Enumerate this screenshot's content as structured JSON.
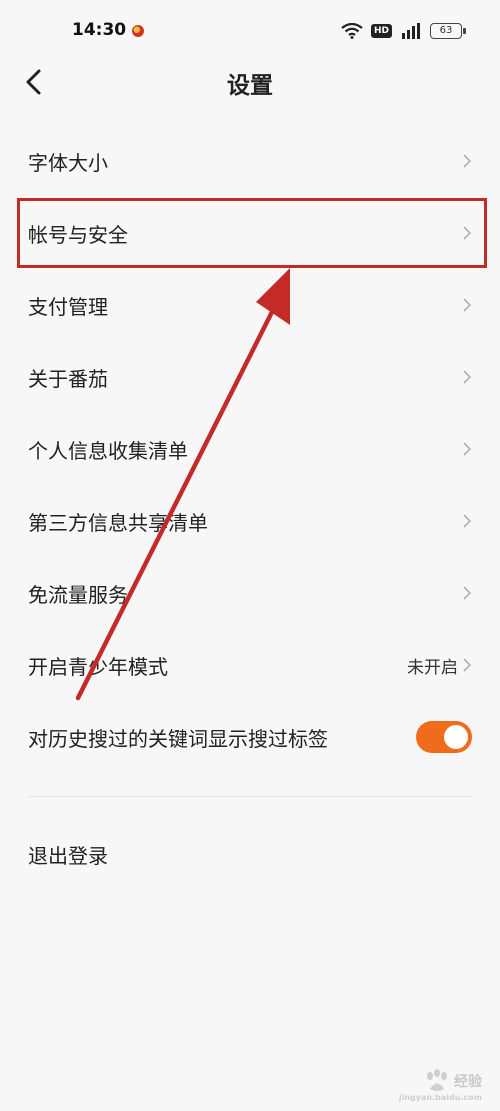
{
  "status_bar": {
    "time": "14:30",
    "hd_badge": "HD",
    "battery": "63",
    "icons": [
      "wifi-icon",
      "hd-icon",
      "signal-icon",
      "battery-icon"
    ]
  },
  "nav": {
    "title": "设置",
    "back_icon": "chevron-left-icon"
  },
  "menu": {
    "items": [
      {
        "label": "字体大小"
      },
      {
        "label": "帐号与安全"
      },
      {
        "label": "支付管理"
      },
      {
        "label": "关于番茄"
      },
      {
        "label": "个人信息收集清单"
      },
      {
        "label": "第三方信息共享清单"
      },
      {
        "label": "免流量服务"
      },
      {
        "label": "开启青少年模式",
        "value": "未开启"
      },
      {
        "label": "对历史搜过的关键词显示搜过标签",
        "toggle": true
      }
    ]
  },
  "logout": {
    "label": "退出登录"
  },
  "annotation": {
    "highlight_color": "#c42a28",
    "highlighted_item": "帐号与安全"
  },
  "watermark": {
    "text": "经验",
    "sub": "jingyan.baidu.com"
  },
  "colors": {
    "background": "#f7f7f7",
    "accent": "#f06b1c",
    "annotation": "#c42a28"
  }
}
